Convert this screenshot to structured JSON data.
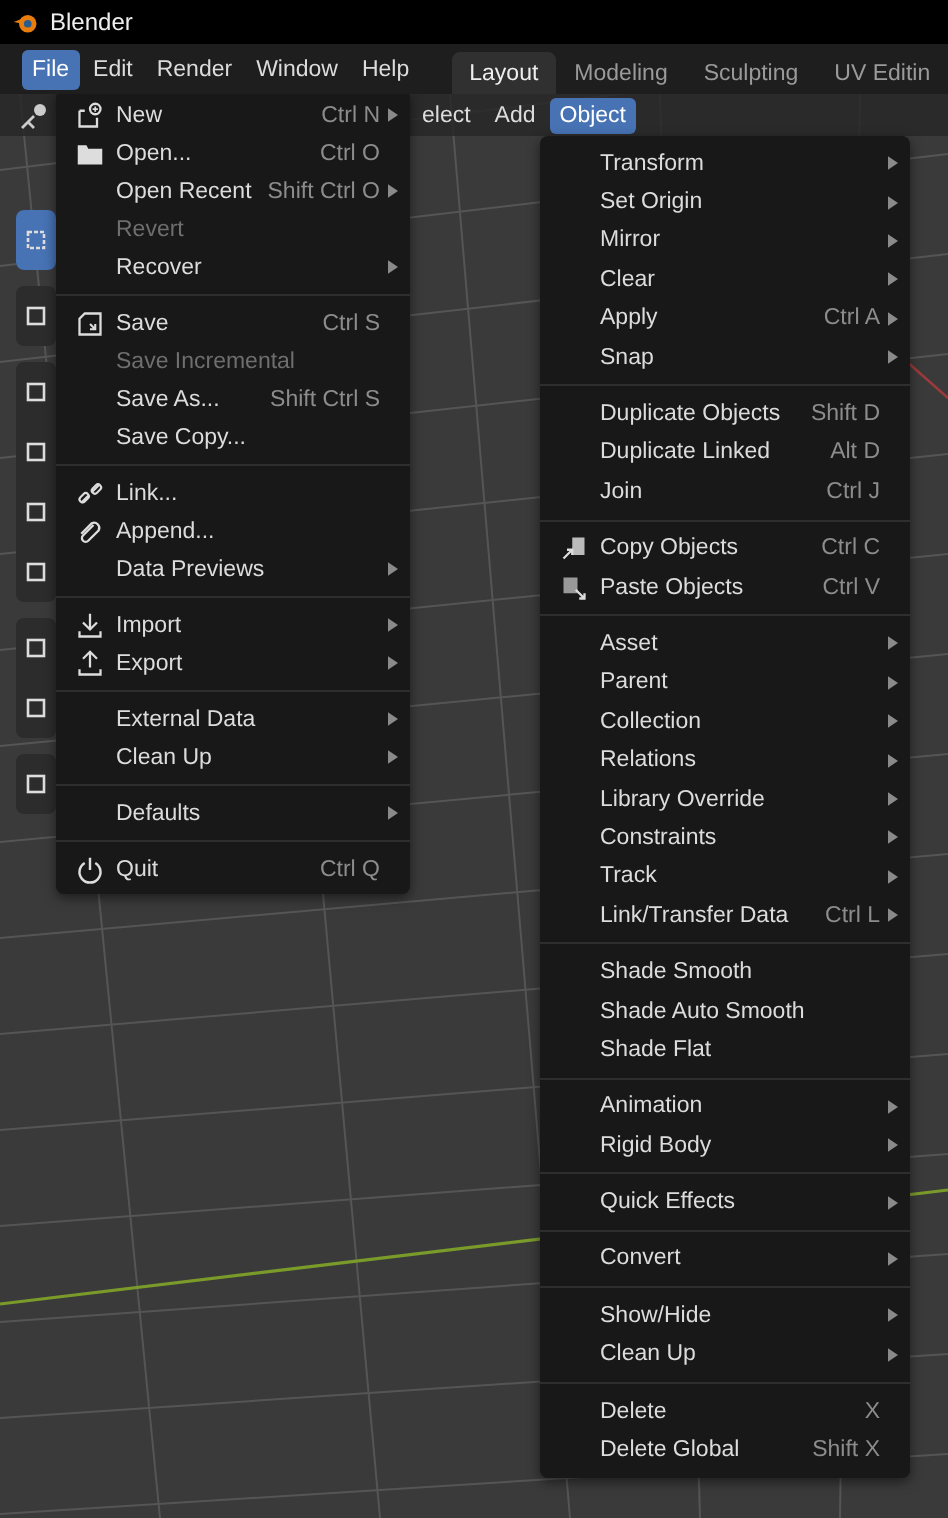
{
  "window": {
    "title": "Blender"
  },
  "menubar": [
    {
      "label": "File",
      "selected": true
    },
    {
      "label": "Edit",
      "selected": false
    },
    {
      "label": "Render",
      "selected": false
    },
    {
      "label": "Window",
      "selected": false
    },
    {
      "label": "Help",
      "selected": false
    }
  ],
  "workspace_tabs": [
    {
      "label": "Layout",
      "selected": true
    },
    {
      "label": "Modeling",
      "selected": false
    },
    {
      "label": "Sculpting",
      "selected": false
    },
    {
      "label": "UV Editin",
      "selected": false
    }
  ],
  "viewport_header": [
    {
      "label": "elect",
      "selected": false
    },
    {
      "label": "Add",
      "selected": false
    },
    {
      "label": "Object",
      "selected": true
    }
  ],
  "file_menu": {
    "sections": [
      {
        "items": [
          {
            "label": "New",
            "shortcut": "Ctrl N",
            "submenu": true,
            "disabled": false
          },
          {
            "label": "Open...",
            "shortcut": "Ctrl O",
            "submenu": false,
            "disabled": false
          },
          {
            "label": "Open Recent",
            "shortcut": "Shift Ctrl O",
            "submenu": true,
            "disabled": false
          },
          {
            "label": "Revert",
            "submenu": false,
            "disabled": true
          },
          {
            "label": "Recover",
            "submenu": true,
            "disabled": false
          }
        ]
      },
      {
        "items": [
          {
            "label": "Save",
            "shortcut": "Ctrl S",
            "submenu": false,
            "disabled": false
          },
          {
            "label": "Save Incremental",
            "submenu": false,
            "disabled": true
          },
          {
            "label": "Save As...",
            "shortcut": "Shift Ctrl S",
            "submenu": false,
            "disabled": false
          },
          {
            "label": "Save Copy...",
            "submenu": false,
            "disabled": false
          }
        ]
      },
      {
        "items": [
          {
            "label": "Link...",
            "submenu": false,
            "disabled": false
          },
          {
            "label": "Append...",
            "submenu": false,
            "disabled": false
          },
          {
            "label": "Data Previews",
            "submenu": true,
            "disabled": false
          }
        ]
      },
      {
        "items": [
          {
            "label": "Import",
            "submenu": true,
            "disabled": false
          },
          {
            "label": "Export",
            "submenu": true,
            "disabled": false
          }
        ]
      },
      {
        "items": [
          {
            "label": "External Data",
            "submenu": true,
            "disabled": false
          },
          {
            "label": "Clean Up",
            "submenu": true,
            "disabled": false
          }
        ]
      },
      {
        "items": [
          {
            "label": "Defaults",
            "submenu": true,
            "disabled": false
          }
        ]
      },
      {
        "items": [
          {
            "label": "Quit",
            "shortcut": "Ctrl Q",
            "submenu": false,
            "disabled": false
          }
        ]
      }
    ]
  },
  "object_menu": {
    "sections": [
      {
        "items": [
          {
            "label": "Transform",
            "submenu": true
          },
          {
            "label": "Set Origin",
            "submenu": true
          },
          {
            "label": "Mirror",
            "submenu": true
          },
          {
            "label": "Clear",
            "submenu": true
          },
          {
            "label": "Apply",
            "shortcut": "Ctrl A",
            "submenu": true
          },
          {
            "label": "Snap",
            "submenu": true
          }
        ]
      },
      {
        "items": [
          {
            "label": "Duplicate Objects",
            "shortcut": "Shift D",
            "submenu": false
          },
          {
            "label": "Duplicate Linked",
            "shortcut": "Alt D",
            "submenu": false
          },
          {
            "label": "Join",
            "shortcut": "Ctrl J",
            "submenu": false
          }
        ]
      },
      {
        "items": [
          {
            "label": "Copy Objects",
            "shortcut": "Ctrl C",
            "submenu": false
          },
          {
            "label": "Paste Objects",
            "shortcut": "Ctrl V",
            "submenu": false
          }
        ]
      },
      {
        "items": [
          {
            "label": "Asset",
            "submenu": true
          },
          {
            "label": "Parent",
            "submenu": true
          },
          {
            "label": "Collection",
            "submenu": true
          },
          {
            "label": "Relations",
            "submenu": true
          },
          {
            "label": "Library Override",
            "submenu": true
          },
          {
            "label": "Constraints",
            "submenu": true
          },
          {
            "label": "Track",
            "submenu": true
          },
          {
            "label": "Link/Transfer Data",
            "shortcut": "Ctrl L",
            "submenu": true
          }
        ]
      },
      {
        "items": [
          {
            "label": "Shade Smooth",
            "submenu": false
          },
          {
            "label": "Shade Auto Smooth",
            "submenu": false
          },
          {
            "label": "Shade Flat",
            "submenu": false
          }
        ]
      },
      {
        "items": [
          {
            "label": "Animation",
            "submenu": true
          },
          {
            "label": "Rigid Body",
            "submenu": true
          }
        ]
      },
      {
        "items": [
          {
            "label": "Quick Effects",
            "submenu": true
          }
        ]
      },
      {
        "items": [
          {
            "label": "Convert",
            "submenu": true
          }
        ]
      },
      {
        "items": [
          {
            "label": "Show/Hide",
            "submenu": true
          },
          {
            "label": "Clean Up",
            "submenu": true
          }
        ]
      },
      {
        "items": [
          {
            "label": "Delete",
            "shortcut": "X",
            "submenu": false
          },
          {
            "label": "Delete Global",
            "shortcut": "Shift X",
            "submenu": false
          }
        ]
      }
    ]
  }
}
